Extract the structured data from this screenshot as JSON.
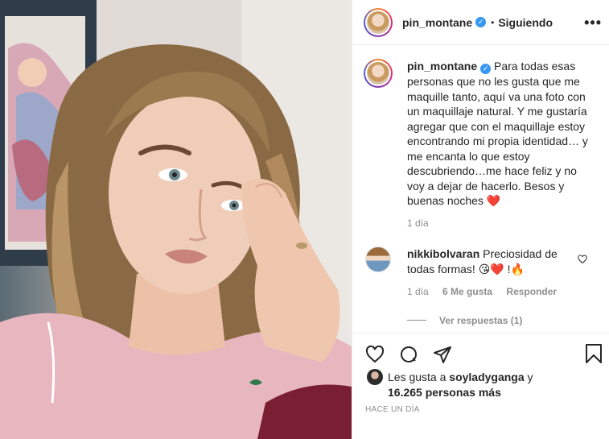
{
  "post": {
    "username": "pin_montane",
    "follow_separator": "•",
    "follow_status": "Siguiendo",
    "more_label": "•••",
    "verified_glyph": "✓"
  },
  "caption": {
    "username": "pin_montane",
    "text": "Para todas esas personas que no les gusta que me maquille tanto, aquí va una foto con un maquillaje natural. Y me gustaría agregar que con el maquillaje estoy encontrando mi propia identidad… y me encanta lo que estoy descubriendo…me hace feliz y no voy a dejar de hacerlo. Besos y buenas noches",
    "emoji": "❤️",
    "time": "1 día"
  },
  "comment": {
    "username": "nikkibolvaran",
    "text": "Preciosidad de todas formas!",
    "emojis": "😘❤️ !🔥",
    "time": "1 día",
    "likes": "6 Me gusta",
    "reply": "Responder",
    "view_replies": "Ver respuestas (1)"
  },
  "likes": {
    "prefix": "Les gusta a",
    "user": "soyladyganga",
    "conj": "y",
    "count": "16.265 personas más"
  },
  "timestamp": "HACE UN DÍA",
  "icons": {
    "like": "heart-icon",
    "comment": "comment-icon",
    "share": "paper-plane-icon",
    "save": "bookmark-icon"
  },
  "colors": {
    "verified": "#3897f0",
    "muted": "#8e8e8e",
    "text": "#262626",
    "heart": "#ed4956"
  }
}
